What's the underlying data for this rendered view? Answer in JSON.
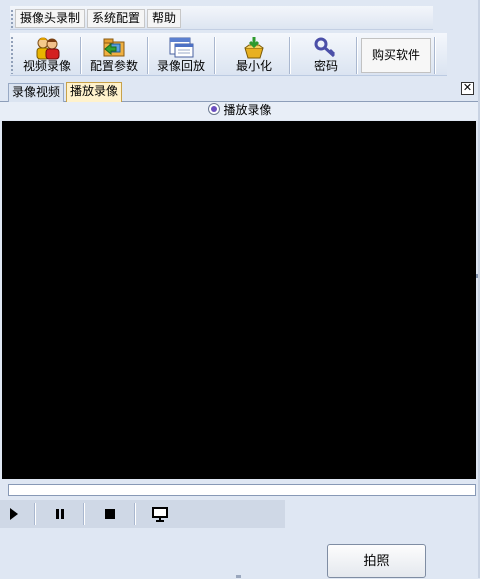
{
  "menu": {
    "items": [
      "摄像头录制",
      "系统配置",
      "帮助"
    ]
  },
  "toolbar": {
    "buttons": [
      {
        "label": "视频录像",
        "icon": "users-icon"
      },
      {
        "label": "配置参数",
        "icon": "settings-folder-icon"
      },
      {
        "label": "录像回放",
        "icon": "playback-window-icon"
      },
      {
        "label": "最小化",
        "icon": "minimize-box-icon"
      },
      {
        "label": "密码",
        "icon": "key-icon"
      }
    ],
    "buy_label": "购买软件"
  },
  "tabs": {
    "items": [
      "录像视频",
      "播放录像"
    ],
    "active": 1,
    "close_glyph": "✕"
  },
  "player": {
    "header_label": "播放录像",
    "progress": 0.0,
    "controls": [
      "play-icon",
      "pause-icon",
      "stop-icon",
      "monitor-icon"
    ],
    "snapshot_label": "拍照"
  },
  "colors": {
    "video_bg": "#000000",
    "active_tab": "#fff2cc",
    "window_bg": "#dfe7f3"
  }
}
